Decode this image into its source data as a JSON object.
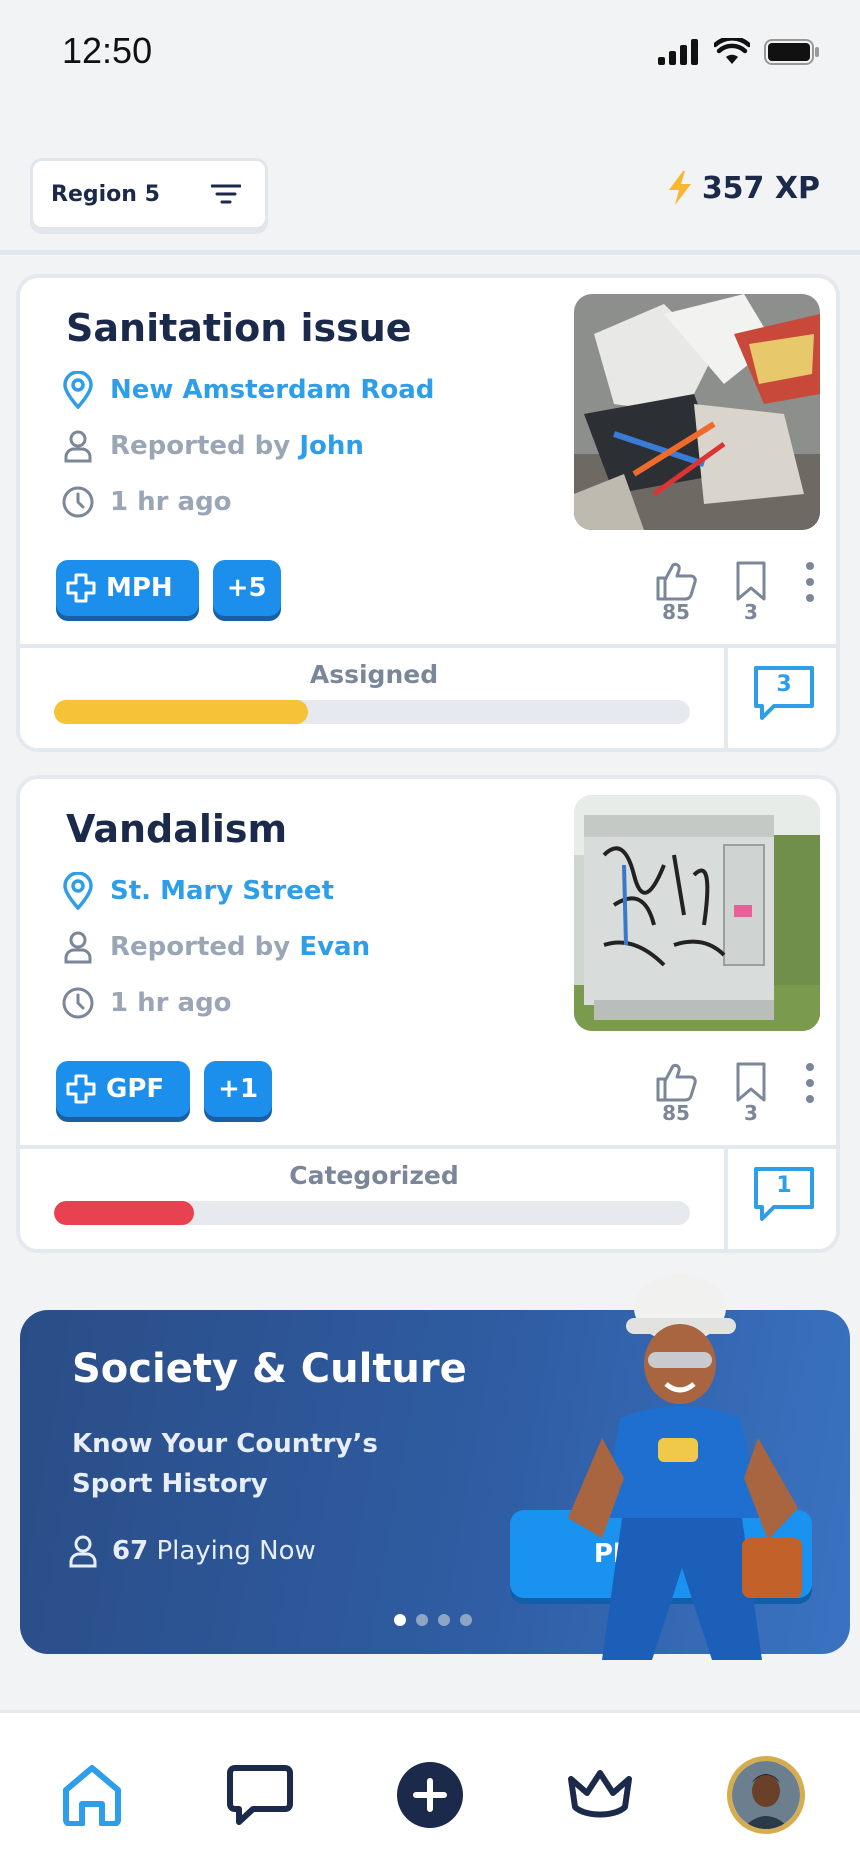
{
  "status_bar": {
    "time": "12:50"
  },
  "header": {
    "region_label": "Region 5",
    "xp_value": "357 XP"
  },
  "cards": [
    {
      "title": "Sanitation issue",
      "location": "New Amsterdam Road",
      "reported_prefix": "Reported by",
      "reporter": "John",
      "time_ago": "1 hr ago",
      "tag": "MPH",
      "tag_more": "+5",
      "likes": "85",
      "bookmarks": "3",
      "status": "Assigned",
      "progress": 0.4,
      "progress_color": "#f6c237",
      "comments": "3",
      "photo": "trash-photo"
    },
    {
      "title": "Vandalism",
      "location": "St. Mary Street",
      "reported_prefix": "Reported by",
      "reporter": "Evan",
      "time_ago": "1 hr ago",
      "tag": "GPF",
      "tag_more": "+1",
      "likes": "85",
      "bookmarks": "3",
      "status": "Categorized",
      "progress": 0.22,
      "progress_color": "#e8414f",
      "comments": "1",
      "photo": "graffiti-photo"
    }
  ],
  "promo": {
    "title": "Society & Culture",
    "subtitle": "Know Your Country’s Sport History",
    "players_count": "67",
    "players_label": "Playing Now",
    "play_label": "Play Now",
    "dots_total": 4,
    "dots_active": 0
  },
  "bottom_nav": [
    "home-icon",
    "chat-icon",
    "add-icon",
    "crown-icon",
    "profile-avatar"
  ],
  "colors": {
    "accent": "#2f9ee8",
    "primary_button": "#1c8eeb",
    "navy": "#1b2a4a"
  }
}
